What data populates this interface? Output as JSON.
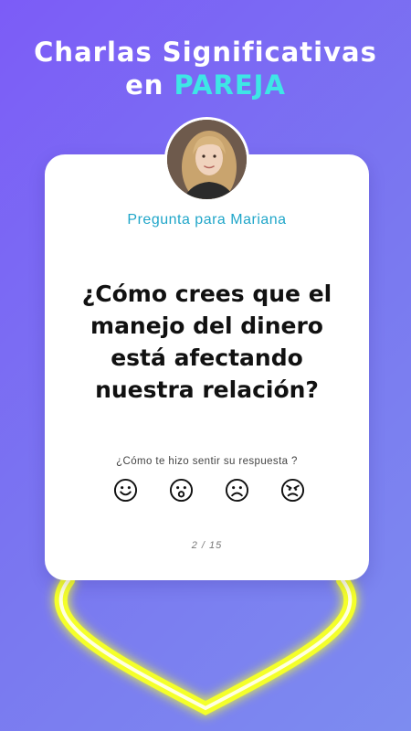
{
  "header": {
    "line1": "Charlas Significativas",
    "line2_prefix": "en ",
    "line2_accent": "PAREJA",
    "accent_color": "#3ee6e6"
  },
  "card": {
    "prompt": "Pregunta para Mariana",
    "question": "¿Cómo crees que el manejo del dinero está afectando nuestra relación?",
    "feeling_prompt": "¿Cómo te hizo sentir su respuesta ?",
    "reactions": [
      "smile-icon",
      "surprised-icon",
      "sad-icon",
      "angry-icon"
    ],
    "counter": "2 / 15"
  },
  "colors": {
    "background_start": "#7c5cf7",
    "background_end": "#7d8cf0",
    "prompt": "#20a6c9",
    "neon": "#f7ff3a"
  }
}
